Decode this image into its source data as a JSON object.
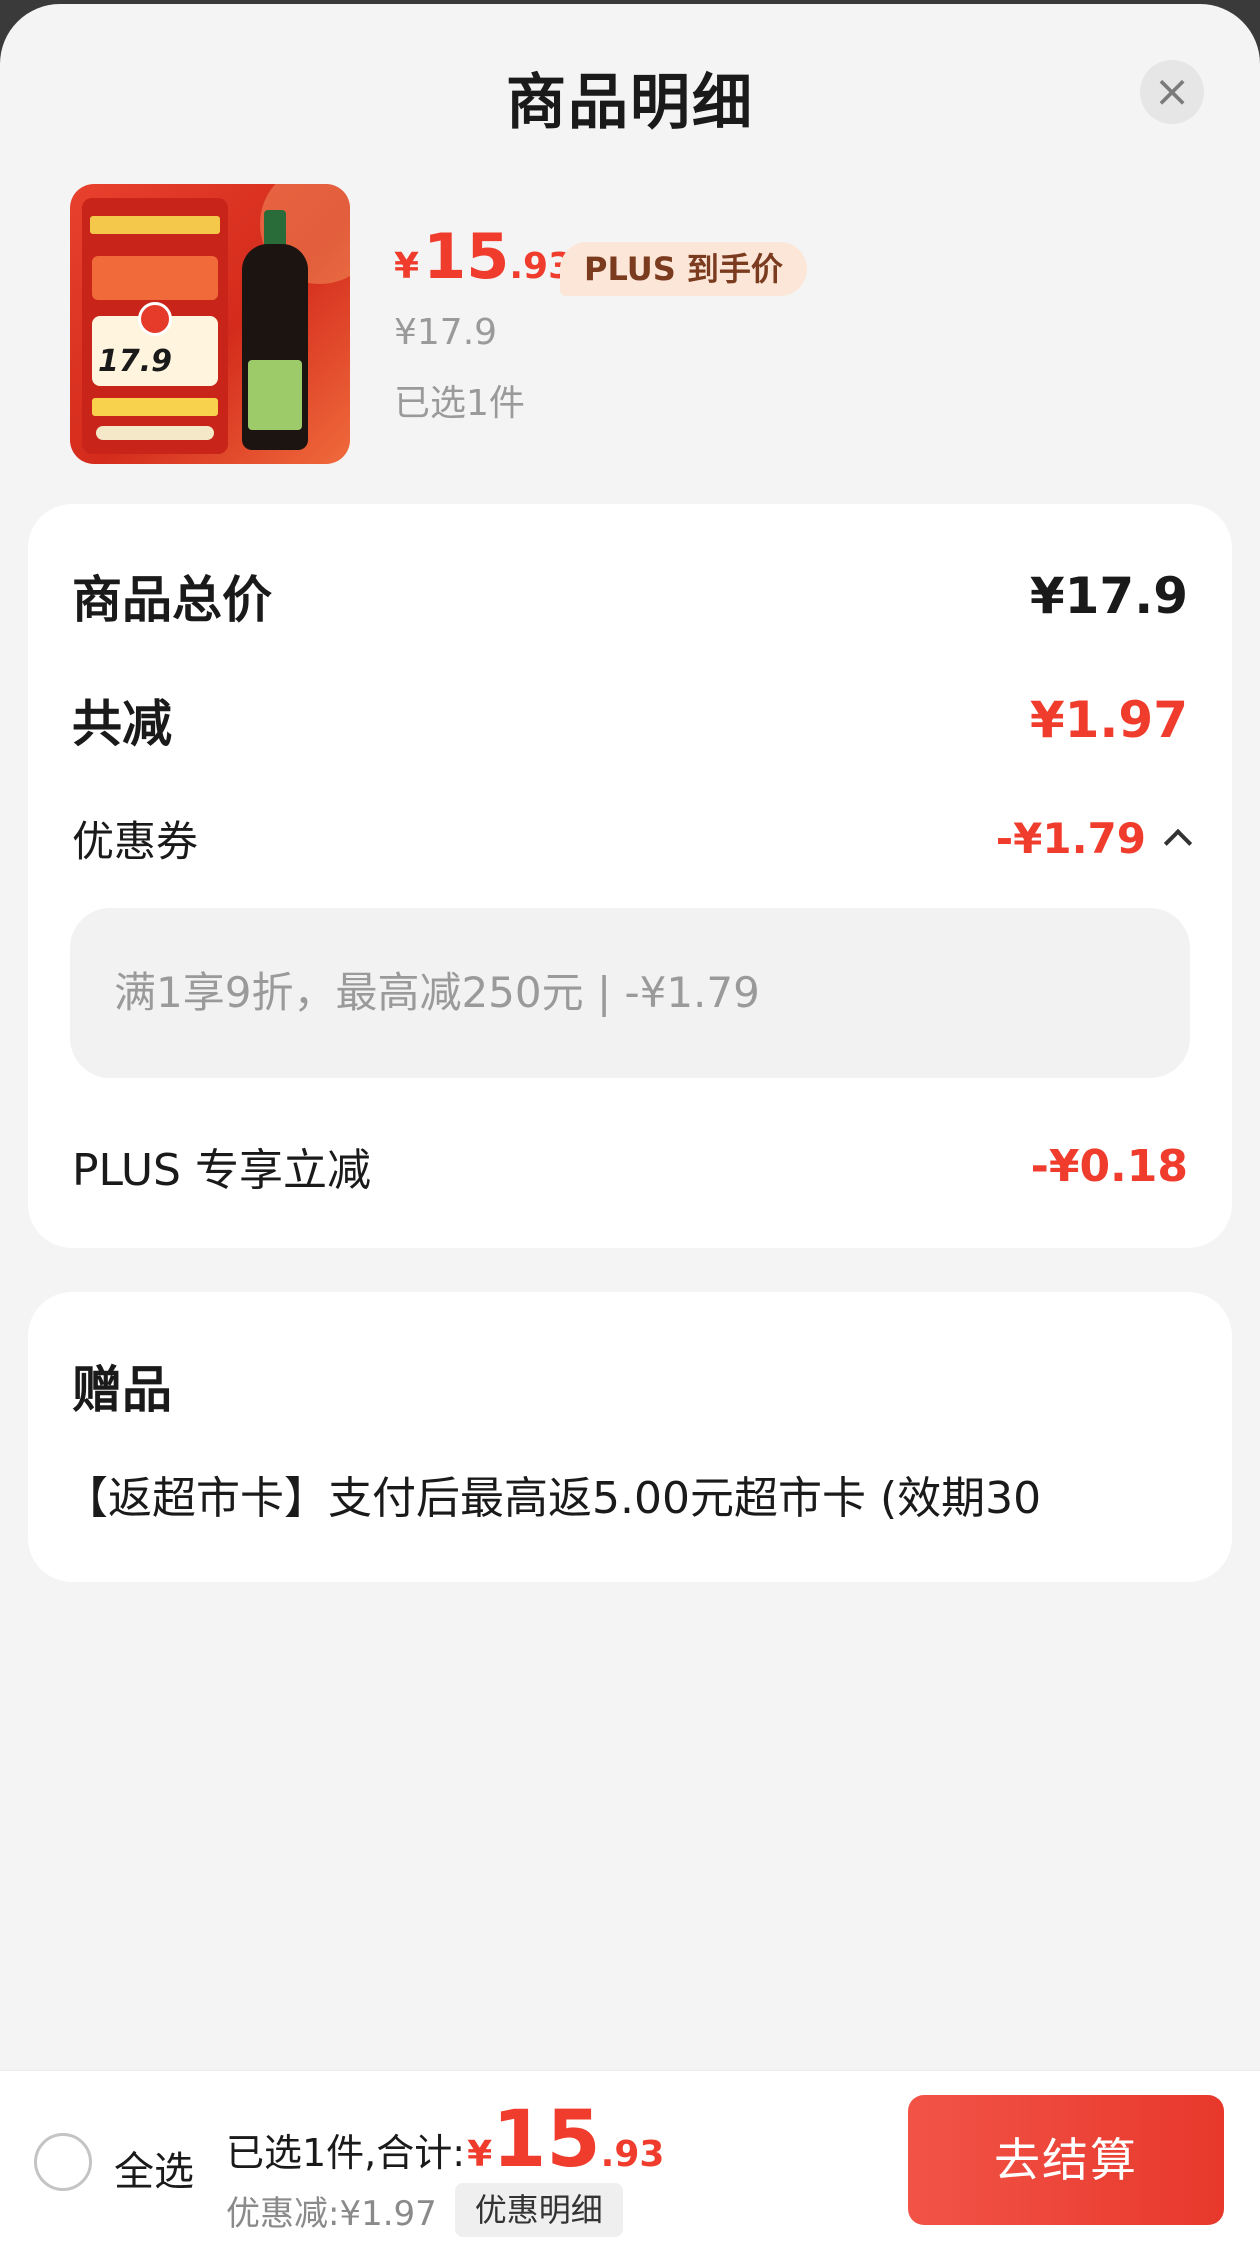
{
  "header": {
    "title": "商品明细",
    "close_icon": "×"
  },
  "product": {
    "image_name": "soy-sauce-product",
    "thumb_price": "17.9",
    "price_yen": "¥",
    "price_int": "15",
    "price_dec": ".93",
    "plus_tag": "PLUS 到手价",
    "original_price": "¥17.9",
    "selected": "已选1件"
  },
  "breakdown": {
    "total_label": "商品总价",
    "total_value": "¥17.9",
    "reduce_label": "共减",
    "reduce_value": "¥1.97",
    "coupon_label": "优惠券",
    "coupon_value": "-¥1.79",
    "coupon_detail": "满1享9折，最高减250元 | -¥1.79",
    "plus_label": "PLUS 专享立减",
    "plus_value": "-¥0.18"
  },
  "gift": {
    "title": "赠品",
    "text": "【返超市卡】支付后最高返5.00元超市卡 (效期30"
  },
  "bottom_bar": {
    "select_all": "全选",
    "summary_text": "已选1件,合计:",
    "total_yen": "¥",
    "total_int": "15",
    "total_dec": ".93",
    "discount_text": "优惠减:¥1.97",
    "detail_button": "优惠明细",
    "checkout_button": "去结算"
  },
  "colors": {
    "accent_red": "#f03c2c",
    "plus_tag_bg": "#fbe6d7",
    "plus_tag_text": "#7a3b1f"
  }
}
